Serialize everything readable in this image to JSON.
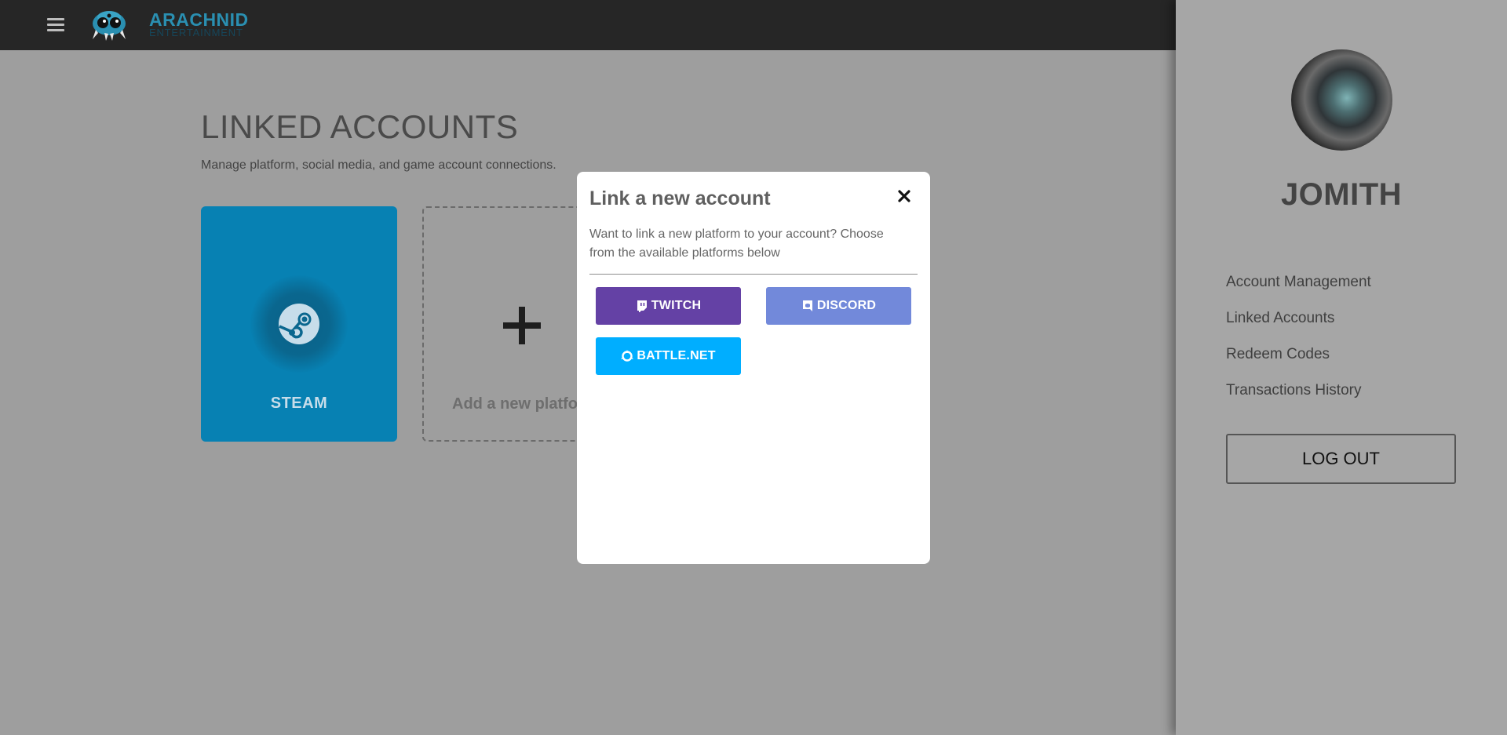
{
  "app": {
    "brand_name": "ARACHNID",
    "brand_sub": "ENTERTAINMENT"
  },
  "icons": {
    "menu": "hamburger-menu-icon",
    "logo": "spider-logo-icon",
    "steam": "steam-icon",
    "add": "plus-icon",
    "close": "close-icon",
    "twitch": "twitch-icon",
    "discord": "discord-icon",
    "battlenet": "battlenet-icon"
  },
  "page": {
    "title": "LINKED ACCOUNTS",
    "subtitle": "Manage platform, social media, and game account connections."
  },
  "accounts": {
    "linked": [
      {
        "name": "STEAM",
        "color": "#0781b3"
      }
    ],
    "add_label": "Add a new platform"
  },
  "modal": {
    "title": "Link a new account",
    "description": "Want to link a new platform to your account? Choose from the available platforms below",
    "platforms": [
      {
        "label": "TWITCH",
        "color": "#6441a5"
      },
      {
        "label": "DISCORD",
        "color": "#7289da"
      },
      {
        "label": "BATTLE.NET",
        "color": "#00aeff"
      }
    ]
  },
  "sidebar": {
    "username": "JOMITH",
    "nav": [
      "Account Management",
      "Linked Accounts",
      "Redeem Codes",
      "Transactions History"
    ],
    "logout_label": "LOG OUT"
  }
}
